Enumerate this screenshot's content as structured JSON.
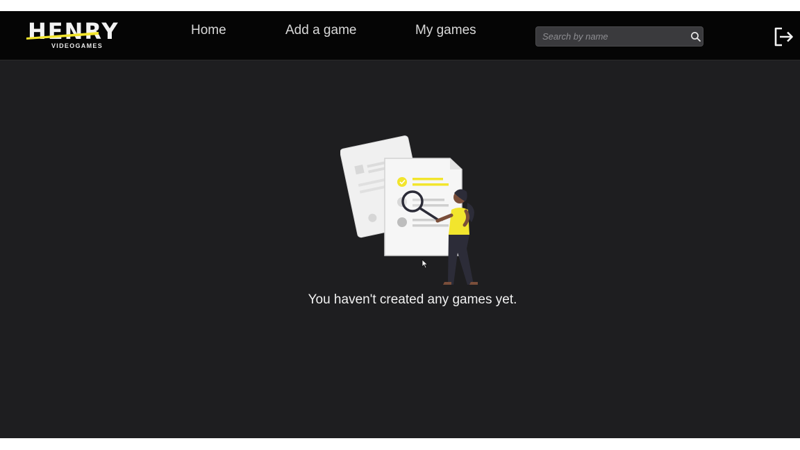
{
  "header": {
    "logo": {
      "brand": "HENRY",
      "subtitle": "VIDEOGAMES"
    },
    "nav": [
      {
        "label": "Home"
      },
      {
        "label": "Add a game"
      },
      {
        "label": "My games"
      }
    ],
    "search": {
      "placeholder": "Search by name",
      "value": ""
    },
    "icons": {
      "search": "search-icon",
      "logout": "logout-icon"
    }
  },
  "main": {
    "empty_message": "You haven't created any games yet.",
    "illustration": "person-with-magnifier-over-documents"
  },
  "colors": {
    "accent": "#f2e52d",
    "background": "#1e1e20",
    "navbar": "#050505"
  }
}
